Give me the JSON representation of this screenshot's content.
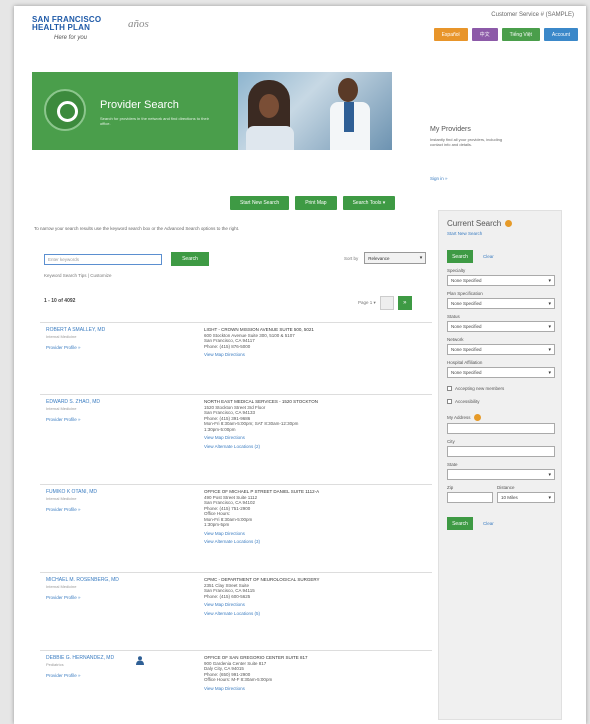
{
  "header": {
    "logo_line1": "SAN FRANCISCO",
    "logo_line2": "HEALTH PLAN",
    "logo_sub": "años",
    "tagline": "Here for you",
    "customer_service": "Customer Service # (SAMPLE)",
    "buttons": [
      {
        "label": "Español",
        "color": "#e8952a"
      },
      {
        "label": "中文",
        "color": "#8c5aa8"
      },
      {
        "label": "Tiếng Việt",
        "color": "#4a9e4b"
      },
      {
        "label": "Account",
        "color": "#3b88c9"
      }
    ]
  },
  "banner": {
    "title": "Provider Search",
    "description": "Search for providers in the network and find directions to their office."
  },
  "my_providers": {
    "title": "My Providers",
    "text": "Instantly find all your providers, including contact info and details.",
    "sign_in": "Sign in »"
  },
  "actions": [
    "Start New Search",
    "Print Map",
    "Search Tools ▾"
  ],
  "instructions": "To narrow your search results use the keyword search box or the Advanced Search options to the right.",
  "search": {
    "placeholder": "Enter keywords",
    "button": "Search",
    "keyword_link": "Keyword Search Tips | Customize",
    "sort_label": "Sort by",
    "sort_value": "Relevance"
  },
  "results_count": "1 - 10 of 4092",
  "page_label": "Page 1 ▾",
  "next_arrow": "»",
  "results": [
    {
      "name": "ROBERT A SMALLEY, MD",
      "specialty": "Internal Medicine",
      "profile": "Provider Profile »",
      "address": [
        "LIGHT - CROWN MISSION AVENUE SUITE 500, 5021",
        "600 Stockton Avenue Suite 300, 5100 & 5107",
        "San Francisco, CA 94117",
        "Phone: (415) 876-5000"
      ],
      "map": "View Map    Directions",
      "extra": ""
    },
    {
      "name": "EDWARD S. ZHAO, MD",
      "specialty": "Internal Medicine",
      "profile": "Provider Profile »",
      "address": [
        "NORTH EAST MEDICAL SERVICES - 1520 STOCKTON",
        "1520 Stockton Street 3rd Floor",
        "San Francisco, CA 94133",
        "Phone: (415) 391-9686",
        "Mon-Fri 8:30am-5:00pm; SAT 8:30am-12:30pm",
        "1:30pm-5:00pm"
      ],
      "map": "View Map    Directions",
      "extra": "View Alternate Locations (2)"
    },
    {
      "name": "FUMIKO K OTANI, MD",
      "specialty": "Internal Medicine",
      "profile": "Provider Profile »",
      "address": [
        "OFFICE OF MICHAEL P STREET DANIEL SUITE 1112-A",
        "490 Post Street Suite 1112",
        "San Francisco, CA 94102",
        "Phone: (415) 751-2900",
        "Office Hours:",
        "Mon-Fri 8:30am-5:00pm",
        "1:30pm-5pm"
      ],
      "map": "View Map    Directions",
      "extra": "View Alternate Locations (3)"
    },
    {
      "name": "MICHAEL M. ROSENBERG, MD",
      "specialty": "Internal Medicine",
      "profile": "Provider Profile »",
      "address": [
        "CPMC - DEPARTMENT OF NEUROLOGICAL SURGERY",
        "2351 Clay Street Suite",
        "San Francisco, CA 94115",
        "Phone: (415) 600-5625"
      ],
      "map": "View Map    Directions",
      "extra": "View Alternate Locations (5)"
    },
    {
      "name": "DEBBIE G. HERNANDEZ, MD",
      "specialty": "Pediatrics",
      "profile": "Provider Profile »",
      "address": [
        "OFFICE OF SAN GREGORIO CENTER SUITE 817",
        "900 Gardenia Center Suite 817",
        "Daly City, CA 94015",
        "Phone: (650) 991-2900",
        "Office Hours: M-F 8:30am-5:00pm"
      ],
      "map": "View Map    Directions",
      "extra": ""
    }
  ],
  "panel": {
    "title": "Current Search",
    "new_search": "Start New Search",
    "search_btn": "Search",
    "clear": "Clear",
    "filters": [
      {
        "label": "Specialty",
        "value": "None Specified"
      },
      {
        "label": "Plan Specification",
        "value": "None Specified"
      },
      {
        "label": "Status",
        "value": "None Specified"
      },
      {
        "label": "Network",
        "value": "None Specified"
      },
      {
        "label": "Hospital Affiliation",
        "value": "None Specified"
      }
    ],
    "check1": "Accepting new members",
    "check2": "Accessibility",
    "address_label": "My Address",
    "city_label": "City",
    "state_label": "State",
    "zip_label": "Zip",
    "distance_label": "Distance",
    "distance_value": "10 Miles",
    "bottom_search": "Search",
    "bottom_clear": "Clear"
  }
}
